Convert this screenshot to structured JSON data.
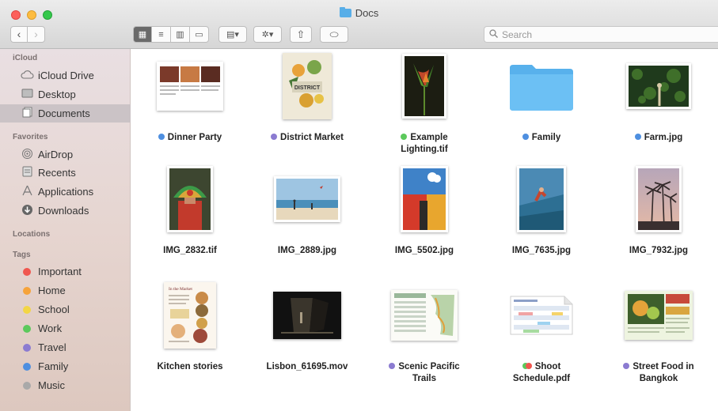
{
  "window": {
    "title": "Docs"
  },
  "toolbar": {
    "back": "‹",
    "forward": "›",
    "view_icons": [
      "▦",
      "≡",
      "▥",
      "▭"
    ],
    "group_icon": "▤▾",
    "action_icon": "✲▾",
    "share_icon": "⇧",
    "tag_icon": "⬭",
    "search_placeholder": "Search",
    "search_icon": "search-icon"
  },
  "sidebar": {
    "icloud_header": "iCloud",
    "icloud": [
      {
        "label": "iCloud Drive",
        "icon": "cloud-icon"
      },
      {
        "label": "Desktop",
        "icon": "desktop-icon"
      },
      {
        "label": "Documents",
        "icon": "documents-icon",
        "selected": true
      }
    ],
    "favorites_header": "Favorites",
    "favorites": [
      {
        "label": "AirDrop",
        "icon": "airdrop-icon"
      },
      {
        "label": "Recents",
        "icon": "recents-icon"
      },
      {
        "label": "Applications",
        "icon": "applications-icon"
      },
      {
        "label": "Downloads",
        "icon": "downloads-icon"
      }
    ],
    "locations_header": "Locations",
    "tags_header": "Tags",
    "tags": [
      {
        "label": "Important",
        "color": "#f0574f"
      },
      {
        "label": "Home",
        "color": "#f6a33a"
      },
      {
        "label": "School",
        "color": "#f3d645"
      },
      {
        "label": "Work",
        "color": "#5cc95c"
      },
      {
        "label": "Travel",
        "color": "#8b7bd1"
      },
      {
        "label": "Family",
        "color": "#4e8fe0"
      },
      {
        "label": "Music",
        "color": "#a9a9a9"
      }
    ]
  },
  "files": [
    {
      "line1": "Dinner Party",
      "line2": "",
      "tag": "#4e8fe0"
    },
    {
      "line1": "District Market",
      "line2": "",
      "tag": "#8b7bd1"
    },
    {
      "line1": "Example",
      "line2": "Lighting.tif",
      "tag": "#5cc95c"
    },
    {
      "line1": "Family",
      "line2": "",
      "tag": "#4e8fe0"
    },
    {
      "line1": "Farm.jpg",
      "line2": "",
      "tag": "#4e8fe0"
    },
    {
      "line1": "IMG_2832.tif",
      "line2": "",
      "tag": ""
    },
    {
      "line1": "IMG_2889.jpg",
      "line2": "",
      "tag": ""
    },
    {
      "line1": "IMG_5502.jpg",
      "line2": "",
      "tag": ""
    },
    {
      "line1": "IMG_7635.jpg",
      "line2": "",
      "tag": ""
    },
    {
      "line1": "IMG_7932.jpg",
      "line2": "",
      "tag": ""
    },
    {
      "line1": "Kitchen stories",
      "line2": "",
      "tag": ""
    },
    {
      "line1": "Lisbon_61695.mov",
      "line2": "",
      "tag": ""
    },
    {
      "line1": "Scenic Pacific",
      "line2": "Trails",
      "tag": "#8b7bd1"
    },
    {
      "line1": "Shoot",
      "line2": "Schedule.pdf",
      "tag": "#5cc95c",
      "tag2": "#f0574f"
    },
    {
      "line1": "Street Food in",
      "line2": "Bangkok",
      "tag": "#8b7bd1"
    }
  ],
  "thumb_text": {
    "district": "DISTRICT",
    "kitchen": "In the Market"
  }
}
